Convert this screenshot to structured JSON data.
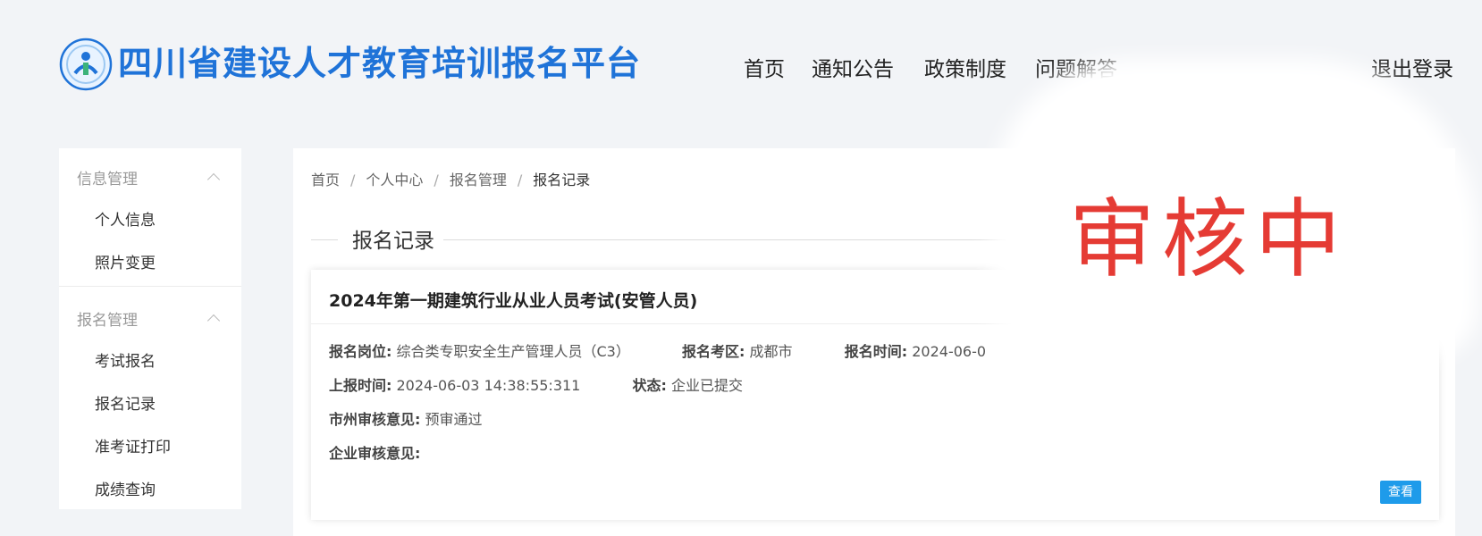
{
  "header": {
    "site_title": "四川省建设人才教育培训报名平台",
    "nav": [
      "首页",
      "通知公告",
      "政策制度",
      "问题解答",
      "退出登录"
    ]
  },
  "sidebar": {
    "groups": [
      {
        "title": "信息管理",
        "items": [
          "个人信息",
          "照片变更"
        ]
      },
      {
        "title": "报名管理",
        "items": [
          "考试报名",
          "报名记录",
          "准考证打印",
          "成绩查询"
        ]
      }
    ]
  },
  "breadcrumb": [
    "首页",
    "个人中心",
    "报名管理",
    "报名记录"
  ],
  "section_title": "报名记录",
  "record": {
    "title": "2024年第一期建筑行业从业人员考试(安管人员)",
    "position_label": "报名岗位:",
    "position_value": "综合类专职安全生产管理人员（C3）",
    "area_label": "报名考区:",
    "area_value": "成都市",
    "time_label": "报名时间:",
    "time_value": "2024-06-0",
    "submit_label": "上报时间:",
    "submit_value": "2024-06-03 14:38:55:311",
    "status_label": "状态:",
    "status_value": "企业已提交",
    "city_review_label": "市州审核意见:",
    "city_review_value": "预审通过",
    "company_review_label": "企业审核意见:",
    "company_review_value": "",
    "view_button": "查看"
  },
  "overlay_text": "审核中",
  "colors": {
    "brand_blue": "#1f73d8",
    "button_blue": "#1e9bea",
    "stamp_red": "#e53b34",
    "page_bg": "#f2f4f7"
  }
}
